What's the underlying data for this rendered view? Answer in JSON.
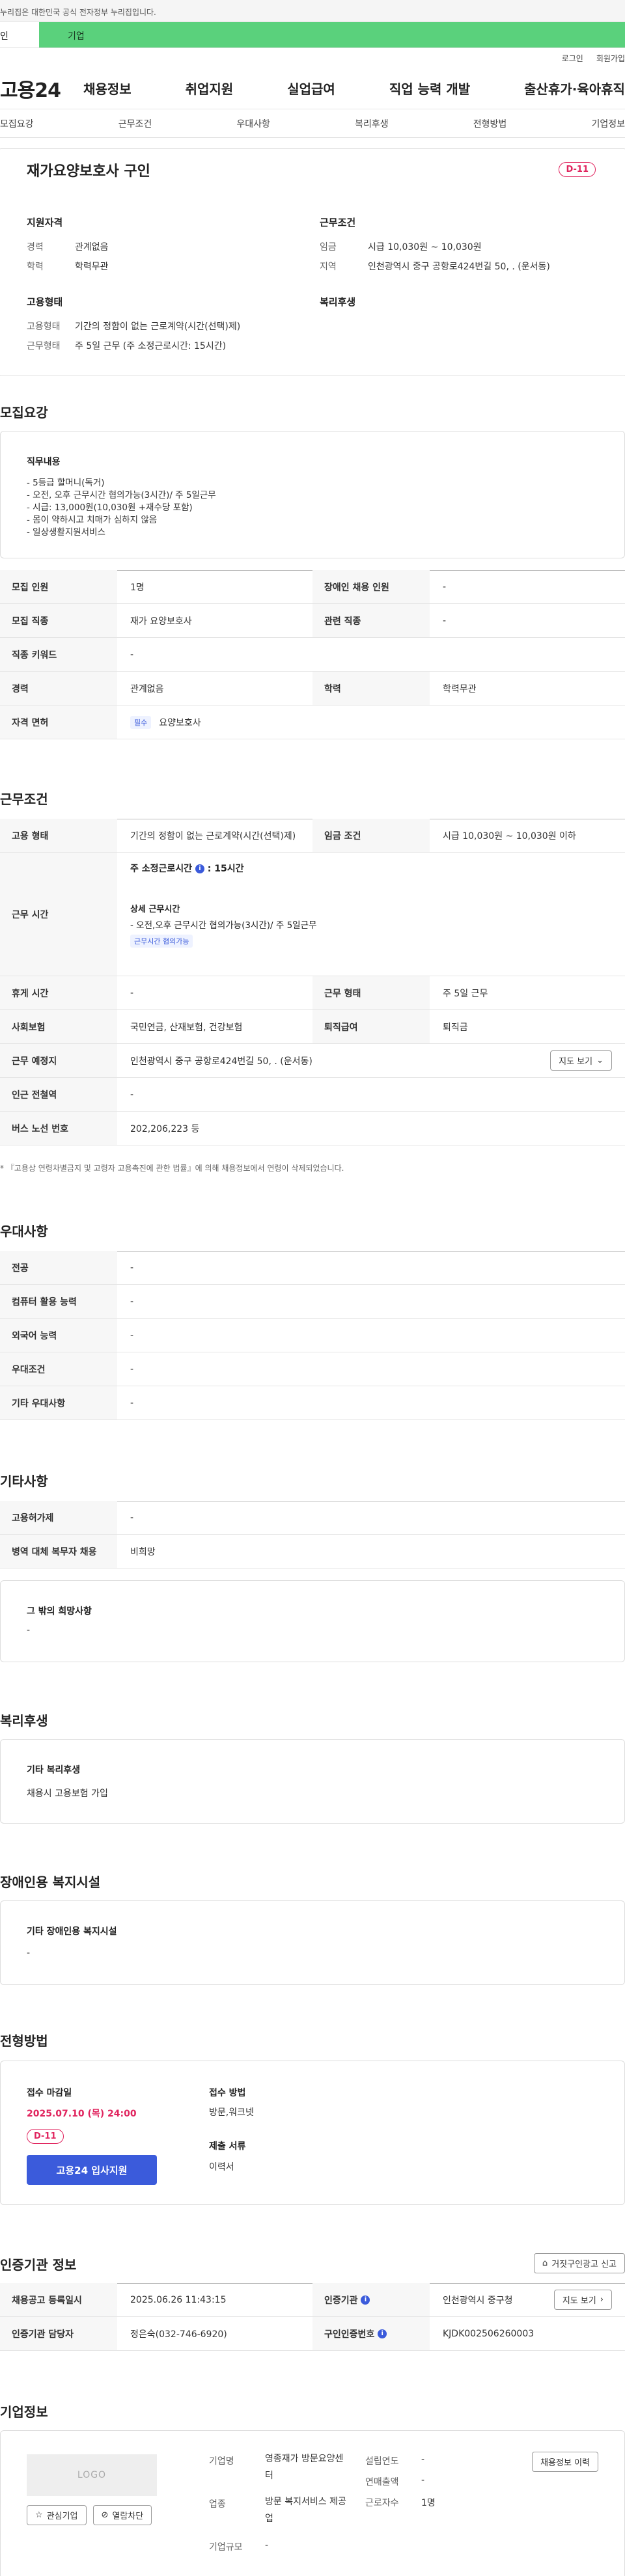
{
  "gov_banner": "누리집은 대한민국 공식 전자정부 누리집입니다.",
  "tabs": {
    "personal": "인",
    "business": "기업"
  },
  "util": {
    "login": "로그인",
    "join": "회원가입"
  },
  "brand": {
    "logo": "고용24"
  },
  "gnb": [
    "채용정보",
    "취업지원",
    "실업급여",
    "직업 능력 개발",
    "출산휴가·육아휴직"
  ],
  "anchor_nav": [
    "모집요강",
    "근무조건",
    "우대사항",
    "복리후생",
    "전형방법",
    "기업정보"
  ],
  "summary": {
    "title": "재가요양보호사 구인",
    "dday": "D-11",
    "qual_h": "지원자격",
    "career_k": "경력",
    "career_v": "관계없음",
    "edu_k": "학력",
    "edu_v": "학력무관",
    "cond_h": "근무조건",
    "wage_k": "임금",
    "wage_v": "시급 10,030원 ~ 10,030원",
    "region_k": "지역",
    "region_v": "인천광역시 중구 공항로424번길 50, . (운서동)",
    "emp_h": "고용형태",
    "emp_k": "고용형태",
    "emp_v": "기간의 정함이 없는 근로계약(시간(선택)제)",
    "work_k": "근무형태",
    "work_v": "주 5일 근무 (주 소정근로시간: 15시간)",
    "welfare_h": "복리후생"
  },
  "recruit": {
    "heading": "모집요강",
    "duty_h": "직무내용",
    "duty_lines": [
      "- 5등급 할머니(독거)",
      "- 오전, 오후 근무시간 협의가능(3시간)/ 주 5일근무",
      "- 시급: 13,000원(10,030원 +재수당 포함)",
      "- 몸이 약하시고 치매가 심하지 않음",
      "- 일상생활지원서비스"
    ],
    "rows": [
      {
        "k1": "모집 인원",
        "v1": "1명",
        "k2": "장애인 채용 인원",
        "v2": "-"
      },
      {
        "k1": "모집 직종",
        "v1": "재가 요양보호사",
        "k2": "관련 직종",
        "v2": "-"
      },
      {
        "k1": "직종 키워드",
        "v1": "-"
      },
      {
        "k1": "경력",
        "v1": "관계없음",
        "k2": "학력",
        "v2": "학력무관"
      }
    ],
    "license_k": "자격 면허",
    "license_tag": "필수",
    "license_v": "요양보호사"
  },
  "conditions": {
    "heading": "근무조건",
    "emp_k": "고용 형태",
    "emp_v": "기간의 정함이 없는 근로계약(시간(선택)제)",
    "wage_k": "임금 조건",
    "wage_v": "시급 10,030원 ~ 10,030원 이하",
    "hours_k": "근무 시간",
    "hours_weekly": "주 소정근로시간",
    "hours_weekly_v": ": 15시간",
    "hours_detail_h": "상세 근무시간",
    "hours_detail_v": "- 오전,오후 근무시간 협의가능(3시간)/ 주 5일근무",
    "hours_tag": "근무시간 협의가능",
    "break_k": "휴게 시간",
    "break_v": "-",
    "worktype_k": "근무 형태",
    "worktype_v": "주 5일 근무",
    "ins_k": "사회보험",
    "ins_v": "국민연금, 산재보험, 건강보험",
    "sev_k": "퇴직급여",
    "sev_v": "퇴직금",
    "place_k": "근무 예정지",
    "place_v": "인천광역시 중구 공항로424번길 50, . (운서동)",
    "map_btn": "지도 보기",
    "subway_k": "인근 전철역",
    "subway_v": "-",
    "bus_k": "버스 노선 번호",
    "bus_v": "202,206,223 등",
    "note": "* 『고용상 연령차별금지 및 고령자 고용촉진에 관한 법률』에 의해 채용정보에서 연령이 삭제되었습니다."
  },
  "preference": {
    "heading": "우대사항",
    "rows": [
      {
        "k": "전공",
        "v": "-"
      },
      {
        "k": "컴퓨터 활용 능력",
        "v": "-"
      },
      {
        "k": "외국어 능력",
        "v": "-"
      },
      {
        "k": "우대조건",
        "v": "-"
      },
      {
        "k": "기타 우대사항",
        "v": "-"
      }
    ]
  },
  "etc": {
    "heading": "기타사항",
    "rows": [
      {
        "k": "고용허가제",
        "v": "-"
      },
      {
        "k": "병역 대체 복무자 채용",
        "v": "비희망"
      }
    ],
    "other_h": "그 밖의 희망사항",
    "other_v": "-"
  },
  "welfare": {
    "heading": "복리후생",
    "box_h": "기타 복리후생",
    "box_v": "채용시 고용보험 가입"
  },
  "disabled": {
    "heading": "장애인용 복지시설",
    "box_h": "기타 장애인용 복지시설",
    "box_v": "-"
  },
  "selection": {
    "heading": "전형방법",
    "deadline_h": "접수 마감일",
    "deadline_v": "2025.07.10 (목) 24:00",
    "dday": "D-11",
    "apply_btn": "고용24 입사지원",
    "method_h": "접수 방법",
    "method_v": "방문,워크넷",
    "docs_h": "제출 서류",
    "docs_v": "이력서"
  },
  "cert": {
    "heading": "인증기관 정보",
    "report_btn": "거짓구인광고 신고",
    "date_k": "채용공고 등록일시",
    "date_v": "2025.06.26 11:43:15",
    "agency_k": "인증기관",
    "agency_v": "인천광역시 중구청",
    "map_btn": "지도 보기",
    "manager_k": "인증기관 담당자",
    "manager_v": "정은숙(032-746-6920)",
    "certno_k": "구인인증번호",
    "certno_v": "KJDK002506260003"
  },
  "company": {
    "heading": "기업정보",
    "logo_ph": "LOGO",
    "fav_btn": "관심기업",
    "block_btn": "열람차단",
    "name_k": "기업명",
    "name_v": "영종재가 방문요양센터",
    "industry_k": "업종",
    "industry_v": "방문 복지서비스 제공업",
    "scale_k": "기업규모",
    "scale_v": "-",
    "founded_k": "설립연도",
    "founded_v": "-",
    "revenue_k": "연매출액",
    "revenue_v": "-",
    "staff_k": "근로자수",
    "staff_v": "1명",
    "jobs_btn": "채용정보 이력"
  },
  "colors": {
    "accent": "#3b5bdb",
    "tab_green": "#5ad17c",
    "dday": "#e0245e"
  }
}
